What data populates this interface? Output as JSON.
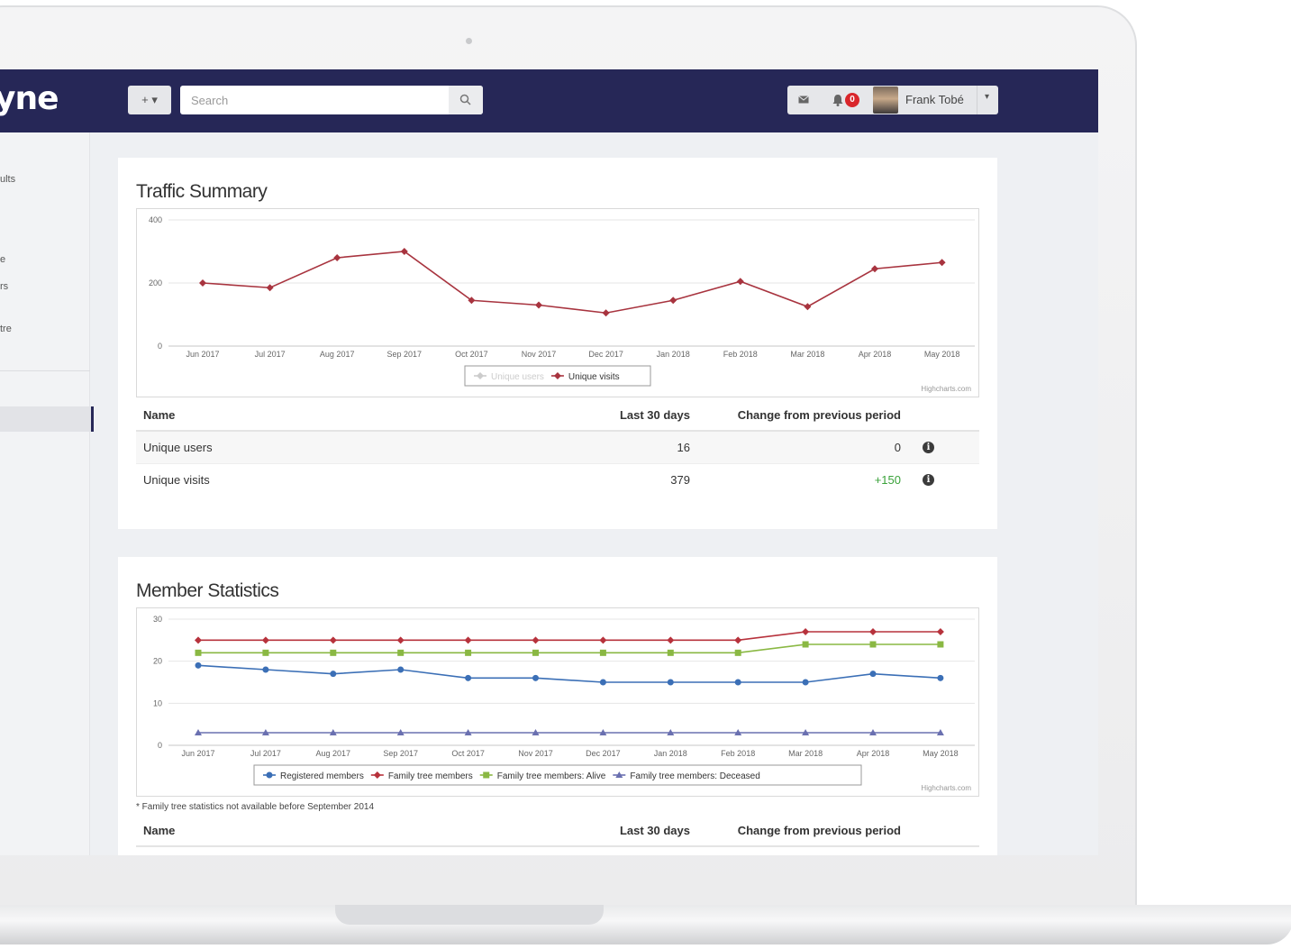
{
  "app": {
    "logo_text": "yne",
    "add_button_label": "+ ▾",
    "search_placeholder": "Search",
    "notification_count": "0",
    "user_name": "Frank Tobé",
    "user_caret": "▾"
  },
  "sidebar": {
    "items": [
      "",
      "ults",
      "",
      "e",
      "rs",
      "tre"
    ]
  },
  "traffic": {
    "title": "Traffic Summary",
    "credit": "Highcharts.com",
    "table": {
      "headers": {
        "name": "Name",
        "last30": "Last 30 days",
        "change": "Change from previous period"
      },
      "rows": [
        {
          "name": "Unique users",
          "last30": "16",
          "change": "0"
        },
        {
          "name": "Unique visits",
          "last30": "379",
          "change": "+150"
        }
      ]
    }
  },
  "members": {
    "title": "Member Statistics",
    "credit": "Highcharts.com",
    "footnote": "* Family tree statistics not available before September 2014",
    "table": {
      "headers": {
        "name": "Name",
        "last30": "Last 30 days",
        "change": "Change from previous period"
      }
    }
  },
  "chart_data": [
    {
      "type": "line",
      "x": [
        "Jun 2017",
        "Jul 2017",
        "Aug 2017",
        "Sep 2017",
        "Oct 2017",
        "Nov 2017",
        "Dec 2017",
        "Jan 2018",
        "Feb 2018",
        "Mar 2018",
        "Apr 2018",
        "May 2018"
      ],
      "series": [
        {
          "name": "Unique users",
          "values": [],
          "color": "#bdbdbd",
          "hidden": true
        },
        {
          "name": "Unique visits",
          "values": [
            200,
            185,
            280,
            300,
            145,
            130,
            105,
            145,
            205,
            125,
            245,
            265
          ],
          "color": "#a8343f"
        }
      ],
      "ylim": [
        0,
        400
      ],
      "yticks": [
        0,
        200,
        400
      ],
      "legend": "bottom-center",
      "grid": true
    },
    {
      "type": "line",
      "x": [
        "Jun 2017",
        "Jul 2017",
        "Aug 2017",
        "Sep 2017",
        "Oct 2017",
        "Nov 2017",
        "Dec 2017",
        "Jan 2018",
        "Feb 2018",
        "Mar 2018",
        "Apr 2018",
        "May 2018"
      ],
      "series": [
        {
          "name": "Registered members",
          "values": [
            19,
            18,
            17,
            18,
            16,
            16,
            15,
            15,
            15,
            15,
            17,
            16
          ],
          "color": "#3b6fb6",
          "marker": "circle"
        },
        {
          "name": "Family tree members",
          "values": [
            25,
            25,
            25,
            25,
            25,
            25,
            25,
            25,
            25,
            27,
            27,
            27
          ],
          "color": "#b7323c",
          "marker": "diamond"
        },
        {
          "name": "Family tree members: Alive",
          "values": [
            22,
            22,
            22,
            22,
            22,
            22,
            22,
            22,
            22,
            24,
            24,
            24
          ],
          "color": "#8ab843",
          "marker": "square"
        },
        {
          "name": "Family tree members: Deceased",
          "values": [
            3,
            3,
            3,
            3,
            3,
            3,
            3,
            3,
            3,
            3,
            3,
            3
          ],
          "color": "#6a70b0",
          "marker": "triangle"
        }
      ],
      "ylim": [
        0,
        30
      ],
      "yticks": [
        0,
        10,
        20,
        30
      ],
      "legend": "bottom-center",
      "grid": true
    }
  ]
}
